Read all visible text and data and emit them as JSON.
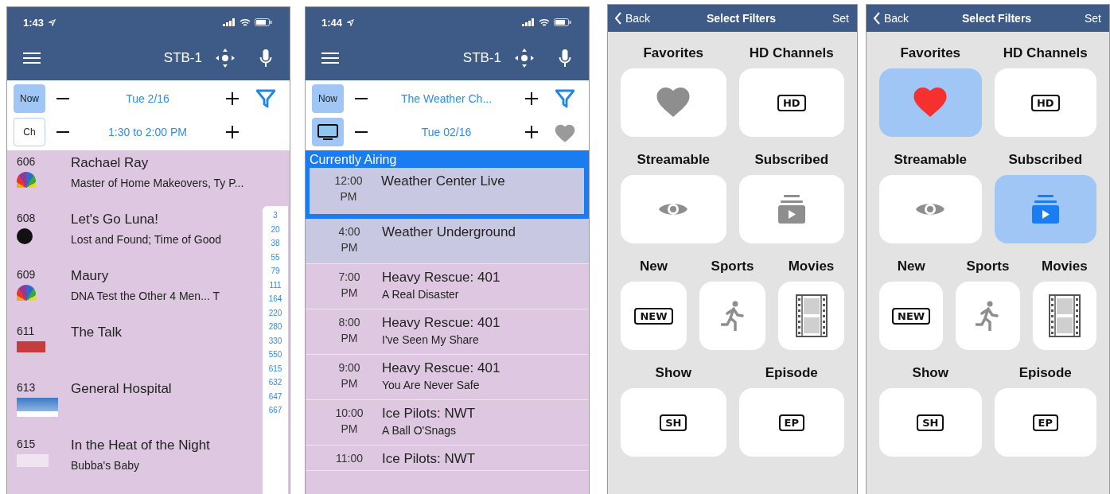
{
  "guide_screen": {
    "status_time": "1:43",
    "device": "STB-1",
    "now_button": {
      "label": "Now",
      "selected": true
    },
    "channel_button": {
      "label": "Ch",
      "selected": false
    },
    "date": "Tue 2/16",
    "time_range": "1:30 to 2:00 PM",
    "channels": [
      {
        "number": "606",
        "kind": "peacock",
        "title": "Rachael Ray",
        "episode": "Master of Home Makeovers, Ty P..."
      },
      {
        "number": "608",
        "kind": "round",
        "title": "Let's Go Luna!",
        "episode": "Lost and Found; Time of Good"
      },
      {
        "number": "609",
        "kind": "peacock",
        "title": "Maury",
        "episode": "DNA Test the Other 4 Men... T"
      },
      {
        "number": "611",
        "kind": "red",
        "title": "The Talk"
      },
      {
        "number": "613",
        "kind": "blue",
        "title": "General Hospital"
      },
      {
        "number": "615",
        "kind": "plain",
        "title": "In the Heat of the Night",
        "episode": "Bubba's Baby"
      }
    ],
    "channel_index": [
      "3",
      "20",
      "38",
      "55",
      "79",
      "111",
      "164",
      "220",
      "280",
      "330",
      "550",
      "615",
      "632",
      "647",
      "667"
    ]
  },
  "schedule_screen": {
    "status_time": "1:44",
    "device": "STB-1",
    "now_button": {
      "label": "Now",
      "selected": true
    },
    "tv_button": {
      "selected": true
    },
    "channel_name": "The Weather Ch...",
    "date": "Tue 02/16",
    "favorite": false,
    "section_title": "Currently Airing",
    "programs": [
      {
        "time": "12:00",
        "period": "PM",
        "title": "Weather Center Live",
        "selected": true,
        "color": "#c9c8e2"
      },
      {
        "time": "4:00",
        "period": "PM",
        "title": "Weather Underground",
        "selected": false,
        "color": "#c9c8e2"
      },
      {
        "time": "7:00",
        "period": "PM",
        "title": "Heavy Rescue: 401",
        "episode": "A Real Disaster",
        "selected": false,
        "color": "#dec7e0"
      },
      {
        "time": "8:00",
        "period": "PM",
        "title": "Heavy Rescue: 401",
        "episode": "I've Seen My Share",
        "selected": false,
        "color": "#dec7e0"
      },
      {
        "time": "9:00",
        "period": "PM",
        "title": "Heavy Rescue: 401",
        "episode": "You Are Never Safe",
        "selected": false,
        "color": "#dec7e0"
      },
      {
        "time": "10:00",
        "period": "PM",
        "title": "Ice Pilots: NWT",
        "episode": "A Ball O'Snags",
        "selected": false,
        "color": "#dec7e0"
      },
      {
        "time": "11:00",
        "title": "Ice Pilots: NWT",
        "selected": false,
        "color": "#dec7e0"
      }
    ]
  },
  "filter_screens": [
    {
      "back": "Back",
      "title": "Select Filters",
      "action": "Set",
      "rows": [
        {
          "filters": [
            {
              "label": "Favorites",
              "kind": "heart",
              "selected": false
            },
            {
              "label": "HD Channels",
              "kind": "tag",
              "tag": "HD",
              "selected": false
            }
          ]
        },
        {
          "filters": [
            {
              "label": "Streamable",
              "kind": "eye",
              "selected": false
            },
            {
              "label": "Subscribed",
              "kind": "stack",
              "selected": false
            }
          ]
        },
        {
          "filters": [
            {
              "label": "New",
              "kind": "tag",
              "tag": "NEW",
              "selected": false
            },
            {
              "label": "Sports",
              "kind": "runner",
              "selected": false
            },
            {
              "label": "Movies",
              "kind": "film",
              "selected": false
            }
          ]
        },
        {
          "filters": [
            {
              "label": "Show",
              "kind": "tag",
              "tag": "SH",
              "selected": false
            },
            {
              "label": "Episode",
              "kind": "tag",
              "tag": "EP",
              "selected": false
            }
          ]
        }
      ]
    },
    {
      "back": "Back",
      "title": "Select Filters",
      "action": "Set",
      "rows": [
        {
          "filters": [
            {
              "label": "Favorites",
              "kind": "heart",
              "selected": true
            },
            {
              "label": "HD Channels",
              "kind": "tag",
              "tag": "HD",
              "selected": false
            }
          ]
        },
        {
          "filters": [
            {
              "label": "Streamable",
              "kind": "eye",
              "selected": false
            },
            {
              "label": "Subscribed",
              "kind": "stack",
              "selected": true
            }
          ]
        },
        {
          "filters": [
            {
              "label": "New",
              "kind": "tag",
              "tag": "NEW",
              "selected": false
            },
            {
              "label": "Sports",
              "kind": "runner",
              "selected": false
            },
            {
              "label": "Movies",
              "kind": "film",
              "selected": false
            }
          ]
        },
        {
          "filters": [
            {
              "label": "Show",
              "kind": "tag",
              "tag": "SH",
              "selected": false
            },
            {
              "label": "Episode",
              "kind": "tag",
              "tag": "EP",
              "selected": false
            }
          ]
        }
      ]
    }
  ]
}
